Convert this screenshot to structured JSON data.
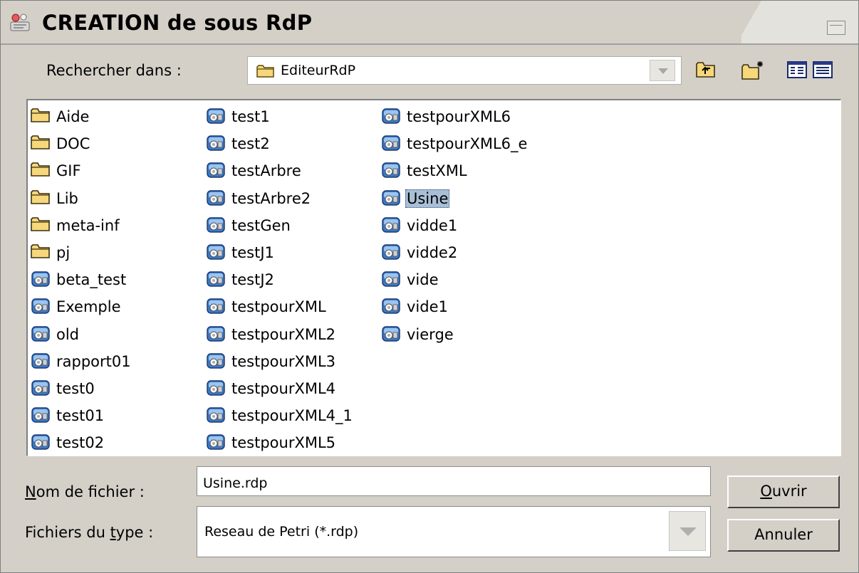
{
  "window": {
    "title": "CREATION de sous RdP"
  },
  "lookin": {
    "label": "Rechercher dans :",
    "value": "EditeurRdP"
  },
  "toolbar": {
    "icons": [
      "up-folder-icon",
      "new-folder-icon",
      "list-view-icon",
      "details-view-icon"
    ]
  },
  "files": {
    "selected": "Usine",
    "columns": [
      [
        {
          "name": "Aide",
          "icon": "folder-icon"
        },
        {
          "name": "DOC",
          "icon": "folder-icon"
        },
        {
          "name": "GIF",
          "icon": "folder-icon"
        },
        {
          "name": "Lib",
          "icon": "folder-icon"
        },
        {
          "name": "meta-inf",
          "icon": "folder-icon"
        },
        {
          "name": "pj",
          "icon": "folder-icon"
        },
        {
          "name": "beta_test",
          "icon": "rdp-file-icon"
        },
        {
          "name": "Exemple",
          "icon": "rdp-file-icon"
        },
        {
          "name": "old",
          "icon": "rdp-file-icon"
        },
        {
          "name": "rapport01",
          "icon": "rdp-file-icon"
        },
        {
          "name": "test0",
          "icon": "rdp-file-icon"
        },
        {
          "name": "test01",
          "icon": "rdp-file-icon"
        },
        {
          "name": "test02",
          "icon": "rdp-file-icon"
        }
      ],
      [
        {
          "name": "test1",
          "icon": "rdp-file-icon"
        },
        {
          "name": "test2",
          "icon": "rdp-file-icon"
        },
        {
          "name": "testArbre",
          "icon": "rdp-file-icon"
        },
        {
          "name": "testArbre2",
          "icon": "rdp-file-icon"
        },
        {
          "name": "testGen",
          "icon": "rdp-file-icon"
        },
        {
          "name": "testJ1",
          "icon": "rdp-file-icon"
        },
        {
          "name": "testJ2",
          "icon": "rdp-file-icon"
        },
        {
          "name": "testpourXML",
          "icon": "rdp-file-icon"
        },
        {
          "name": "testpourXML2",
          "icon": "rdp-file-icon"
        },
        {
          "name": "testpourXML3",
          "icon": "rdp-file-icon"
        },
        {
          "name": "testpourXML4",
          "icon": "rdp-file-icon"
        },
        {
          "name": "testpourXML4_1",
          "icon": "rdp-file-icon"
        },
        {
          "name": "testpourXML5",
          "icon": "rdp-file-icon"
        }
      ],
      [
        {
          "name": "testpourXML6",
          "icon": "rdp-file-icon"
        },
        {
          "name": "testpourXML6_e",
          "icon": "rdp-file-icon"
        },
        {
          "name": "testXML",
          "icon": "rdp-file-icon"
        },
        {
          "name": "Usine",
          "icon": "rdp-file-icon"
        },
        {
          "name": "vidde1",
          "icon": "rdp-file-icon"
        },
        {
          "name": "vidde2",
          "icon": "rdp-file-icon"
        },
        {
          "name": "vide",
          "icon": "rdp-file-icon"
        },
        {
          "name": "vide1",
          "icon": "rdp-file-icon"
        },
        {
          "name": "vierge",
          "icon": "rdp-file-icon"
        }
      ]
    ]
  },
  "filename": {
    "label_mnemonic": "N",
    "label_rest": "om de fichier :",
    "value": "Usine.rdp"
  },
  "filetype": {
    "label_before": "Fichiers du ",
    "label_mnemonic": "t",
    "label_after": "ype :",
    "value": "Reseau de Petri (*.rdp)"
  },
  "buttons": {
    "open_mnemonic": "O",
    "open_rest": "uvrir",
    "cancel": "Annuler"
  }
}
